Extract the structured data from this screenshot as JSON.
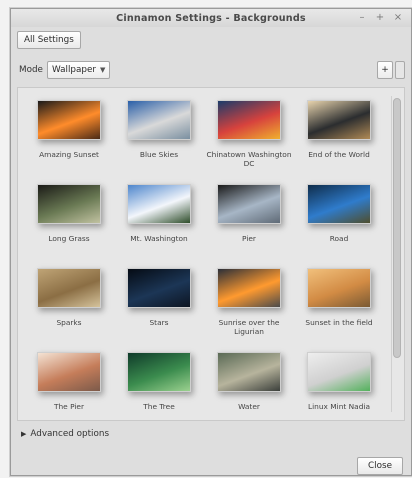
{
  "window": {
    "title": "Cinnamon Settings - Backgrounds",
    "controls": {
      "minimize": "–",
      "maximize": "+",
      "close": "×"
    }
  },
  "toolbar": {
    "all_settings": "All Settings"
  },
  "mode": {
    "label": "Mode",
    "value": "Wallpaper",
    "add": "+"
  },
  "gallery": {
    "items": [
      {
        "name": "Amazing Sunset",
        "colors": [
          "#1a1a1a",
          "#ff8c2b",
          "#4a2a16"
        ]
      },
      {
        "name": "Blue Skies",
        "colors": [
          "#2a5fa8",
          "#d9d9d9",
          "#7a8fa0"
        ]
      },
      {
        "name": "Chinatown Washington DC",
        "colors": [
          "#1b3b6a",
          "#d7423d",
          "#f0b02e"
        ]
      },
      {
        "name": "End of the World",
        "colors": [
          "#e7d3ad",
          "#2b2d2f",
          "#b08a55"
        ]
      },
      {
        "name": "Long Grass",
        "colors": [
          "#1b1b17",
          "#6a7a54",
          "#c1c2a1"
        ]
      },
      {
        "name": "Mt. Washington",
        "colors": [
          "#4e86cc",
          "#f3f6fb",
          "#2e4d2a"
        ]
      },
      {
        "name": "Pier",
        "colors": [
          "#1a1a1a",
          "#a7b6c6",
          "#5f6a76"
        ]
      },
      {
        "name": "Road",
        "colors": [
          "#0f2d4b",
          "#2f7ccc",
          "#4f4e2d"
        ]
      },
      {
        "name": "Sparks",
        "colors": [
          "#bfa476",
          "#8b6e44",
          "#d5c39c"
        ]
      },
      {
        "name": "Stars",
        "colors": [
          "#050b14",
          "#1c3656",
          "#0d1522"
        ]
      },
      {
        "name": "Sunrise over the Ligurian",
        "colors": [
          "#2b2f38",
          "#ff9a2f",
          "#4b4b4b"
        ]
      },
      {
        "name": "Sunset in the field",
        "colors": [
          "#f1c07c",
          "#d28b44",
          "#7a5a34"
        ]
      },
      {
        "name": "The Pier",
        "colors": [
          "#f4e3d4",
          "#c57d5a",
          "#7c5a4a"
        ]
      },
      {
        "name": "The Tree",
        "colors": [
          "#0f3b2a",
          "#3b8c4e",
          "#9bd18f"
        ]
      },
      {
        "name": "Water",
        "colors": [
          "#5a6a55",
          "#b7b49d",
          "#3b3f3b"
        ]
      },
      {
        "name": "Linux Mint Nadia",
        "colors": [
          "#eeeeee",
          "#d0d0d0",
          "#53b15c"
        ]
      }
    ]
  },
  "advanced": {
    "label": "Advanced options"
  },
  "footer": {
    "close": "Close"
  }
}
